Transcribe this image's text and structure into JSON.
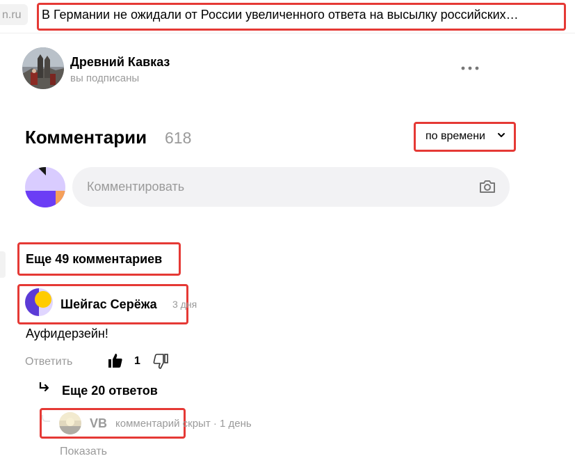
{
  "browser": {
    "prev_tab_fragment": "n.ru",
    "headline": "В Германии не ожидали от России увеличенного ответа на высылку российских…"
  },
  "channel": {
    "name": "Древний Кавказ",
    "subscription_status": "вы подписаны"
  },
  "comments": {
    "title": "Комментарии",
    "count": "618",
    "sort_label": "по времени",
    "input_placeholder": "Комментировать",
    "more_label": "Еще 49 комментариев"
  },
  "comment": {
    "author": "Шейгас Серёжа",
    "time": "3 дня",
    "text": "Ауфидерзейн!",
    "reply_label": "Ответить",
    "likes": "1"
  },
  "replies": {
    "more_label": "Еще 20 ответов",
    "hidden_reply": {
      "author": "VB",
      "status": "комментарий скрыт · 1 день",
      "show_label": "Показать"
    }
  },
  "colors": {
    "highlight": "#e53935",
    "muted_text": "#9a9a9a",
    "input_bg": "#f2f2f4"
  }
}
